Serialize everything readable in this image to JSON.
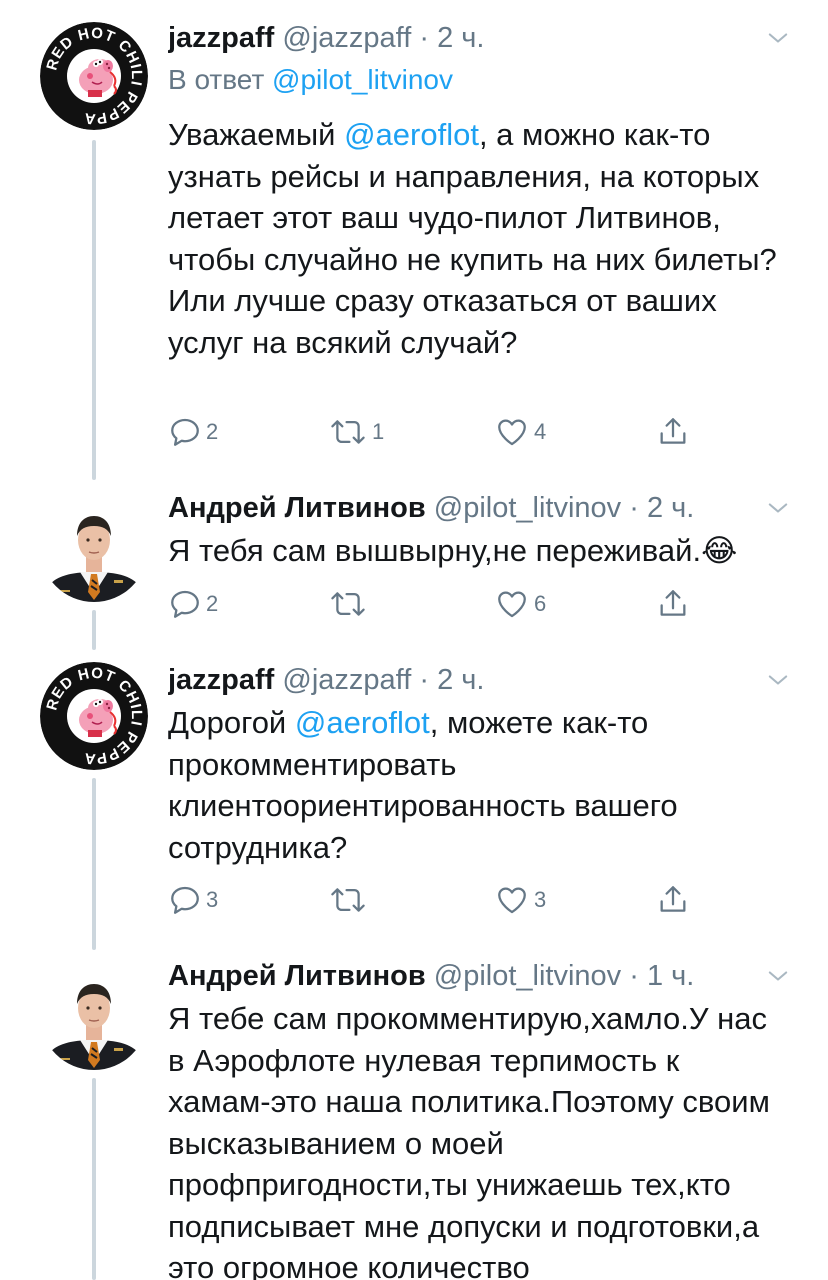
{
  "tweets": [
    {
      "display_name": "jazzpaff",
      "handle": "@jazzpaff",
      "dot": "·",
      "time": "2 ч.",
      "reply_prefix": "В ответ",
      "reply_handle": "@pilot_litvinov",
      "text_parts": [
        "Уважаемый ",
        "@aeroflot",
        ", а можно как-то узнать рейсы и направления, на которых летает этот ваш чудо-пилот Литвинов, чтобы случайно не купить на них билеты? Или лучше сразу отказаться от ваших услуг на всякий случай?"
      ],
      "replies": "2",
      "retweets": "1",
      "likes": "4",
      "avatar_text": "RED HOT CHILI PEPPA"
    },
    {
      "display_name": "Андрей Литвинов",
      "handle": "@pilot_litvinov",
      "dot": "·",
      "time": "2 ч.",
      "text": "Я тебя сам вышвырну,не переживай.",
      "emoji": "😂",
      "replies": "2",
      "retweets": "",
      "likes": "6"
    },
    {
      "display_name": "jazzpaff",
      "handle": "@jazzpaff",
      "dot": "·",
      "time": "2 ч.",
      "text_parts": [
        "Дорогой ",
        "@aeroflot",
        ", можете как-то прокомментировать клиентоориентированность вашего сотрудника?"
      ],
      "replies": "3",
      "retweets": "",
      "likes": "3",
      "avatar_text": "RED HOT CHILI PEPPA"
    },
    {
      "display_name": "Андрей Литвинов",
      "handle": "@pilot_litvinov",
      "dot": "·",
      "time": "1 ч.",
      "text": "Я тебе сам прокомментирую,хамло.У нас в Аэрофлоте нулевая терпимость к хамам-это наша политика.Поэтому своим высказыванием о моей профпригодности,ты унижаешь тех,кто подписывает мне допуски и подготовки,а это огромное количество"
    }
  ],
  "icons": {
    "reply": "reply-icon",
    "retweet": "retweet-icon",
    "like": "heart-icon",
    "share": "share-icon",
    "more": "chevron-down-icon"
  },
  "colors": {
    "link": "#1da1f2",
    "secondary_text": "#657786",
    "thread_line": "#ccd6dd",
    "text": "#14171a"
  }
}
